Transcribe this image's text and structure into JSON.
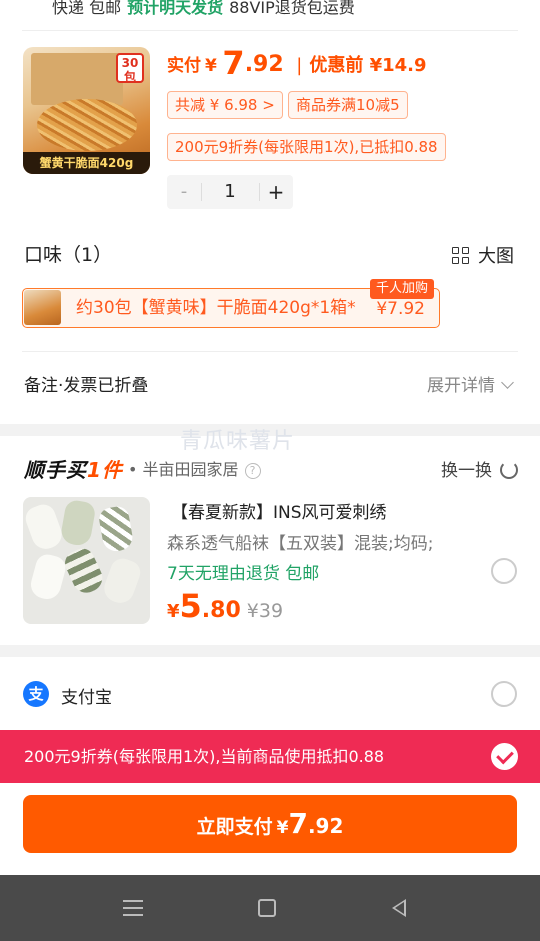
{
  "shipping": {
    "method": "快递 包邮",
    "estimate": "预计明天发货",
    "vip": "88VIP退货包运费"
  },
  "product": {
    "image_caption": "蟹黄干脆面420g",
    "image_badge": "30包",
    "pay_label": "实付",
    "currency": "¥",
    "pay_int": "7",
    "pay_dec": ".92",
    "separator": "|",
    "pre_discount": "优惠前 ¥14.9",
    "total_discount": "共减 ¥ 6.98 >",
    "coupon_tag": "商品券满10减5",
    "coupon_info": "200元9折券(每张限用1次),已抵扣0.88",
    "qty_minus": "-",
    "qty": "1",
    "qty_plus": "+"
  },
  "flavor": {
    "title": "口味（1）",
    "big_pic": "大图",
    "option_text": "约30包【蟹黄味】干脆面420g*1箱*",
    "option_price": "¥7.92",
    "hot_badge": "千人加购"
  },
  "notes": {
    "label": "备注·发票已折叠",
    "expand": "展开详情"
  },
  "watermark": "青瓜味薯片",
  "addon": {
    "brand_a": "顺手买",
    "brand_b": "1件",
    "shop": "• 半亩田园家居",
    "help": "?",
    "swap": "换一换",
    "title": "【春夏新款】INS风可爱刺绣",
    "desc": "森系透气船袜【五双装】混装;均码;",
    "ship": "7天无理由退货  包邮",
    "currency": "¥",
    "price_int": "5",
    "price_dec": ".80",
    "orig_price": "¥39"
  },
  "payment": {
    "method": "支付宝",
    "icon_char": "支"
  },
  "coupon_bar": {
    "text": "200元9折券(每张限用1次),当前商品使用抵扣0.88"
  },
  "pay_button": {
    "label": "立即支付",
    "currency": "¥",
    "int": "7",
    "dec": ".92"
  },
  "colors": {
    "accent": "#ff5a00",
    "coupon_bar": "#ef2b54",
    "green": "#21a366",
    "alipay": "#1677ff"
  }
}
